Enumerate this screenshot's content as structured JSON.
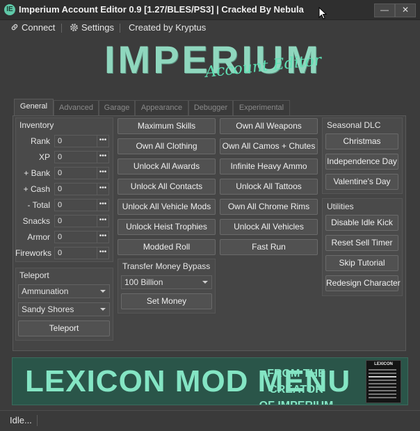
{
  "window": {
    "title": "Imperium Account Editor 0.9  [1.27/BLES/PS3] | Cracked By Nebula",
    "minimize": "—",
    "close": "✕"
  },
  "menu": {
    "connect": "Connect",
    "settings": "Settings",
    "credit": "Created by Kryptus"
  },
  "logo": {
    "title": "IMPERIUM",
    "subtitle": "Account Editor"
  },
  "tabs": [
    {
      "label": "General",
      "active": true
    },
    {
      "label": "Advanced",
      "active": false
    },
    {
      "label": "Garage",
      "active": false
    },
    {
      "label": "Appearance",
      "active": false
    },
    {
      "label": "Debugger",
      "active": false
    },
    {
      "label": "Experimental",
      "active": false
    }
  ],
  "inventory": {
    "title": "Inventory",
    "fields": [
      {
        "label": "Rank",
        "value": "0"
      },
      {
        "label": "XP",
        "value": "0"
      },
      {
        "label": "+ Bank",
        "value": "0"
      },
      {
        "label": "+ Cash",
        "value": "0"
      },
      {
        "label": "- Total",
        "value": "0"
      },
      {
        "label": "Snacks",
        "value": "0"
      },
      {
        "label": "Armor",
        "value": "0"
      },
      {
        "label": "Fireworks",
        "value": "0"
      }
    ],
    "dots": "•••"
  },
  "teleport": {
    "title": "Teleport",
    "category": "Ammunation",
    "location": "Sandy Shores",
    "button": "Teleport"
  },
  "actions": {
    "col1": [
      "Maximum Skills",
      "Own All Clothing",
      "Unlock All Awards",
      "Unlock All Contacts",
      "Unlock All Vehicle Mods",
      "Unlock Heist Trophies",
      "Modded Roll"
    ],
    "col2": [
      "Own All Weapons",
      "Own All Camos + Chutes",
      "Infinite Heavy Ammo",
      "Unlock All Tattoos",
      "Own All Chrome Rims",
      "Unlock All Vehicles",
      "Fast Run"
    ]
  },
  "transfer": {
    "title": "Transfer Money Bypass",
    "amount": "100 Billion",
    "button": "Set Money"
  },
  "seasonal": {
    "title": "Seasonal DLC",
    "buttons": [
      "Christmas",
      "Independence Day",
      "Valentine's Day"
    ]
  },
  "utilities": {
    "title": "Utilities",
    "buttons": [
      "Disable Idle Kick",
      "Reset Sell Timer",
      "Skip Tutorial",
      "Redesign Character"
    ]
  },
  "banner": {
    "title": "LEXICON MOD MENU",
    "tagline_1": "FROM THE CREATOR",
    "tagline_2": "OF IMPERIUM",
    "preview_title": "LEXICON"
  },
  "status": {
    "text": "Idle..."
  },
  "colors": {
    "background": "#3c3c3c",
    "accent": "#84e5c4",
    "banner": "#2a5549"
  },
  "icons": {
    "app": "imperium-logo-icon",
    "connect": "link-icon",
    "settings": "gear-icon"
  }
}
